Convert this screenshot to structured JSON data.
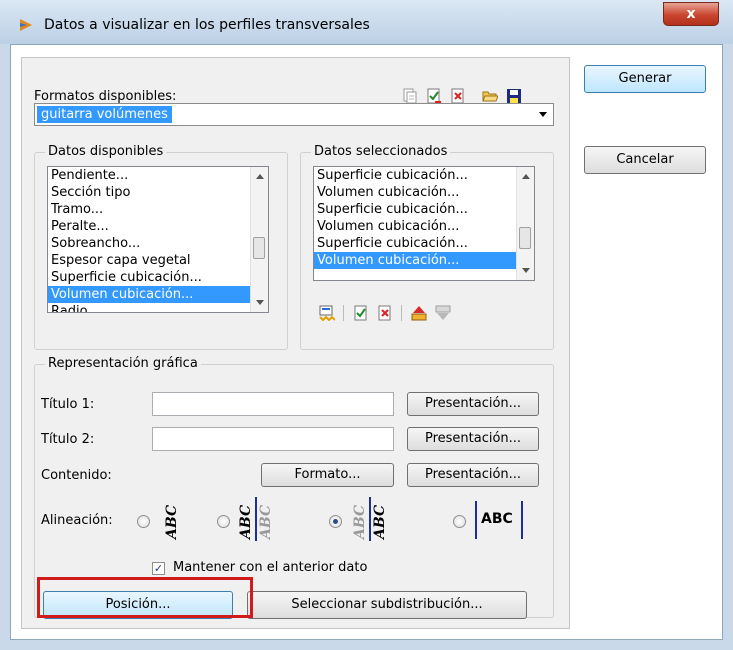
{
  "window": {
    "title": "Datos a visualizar en los perfiles transversales",
    "close_label": "x"
  },
  "formats": {
    "label": "Formatos disponibles:",
    "selected": "guitarra volúmenes"
  },
  "available": {
    "title": "Datos disponibles",
    "items": [
      "Pendiente...",
      "Sección tipo",
      "Tramo...",
      "Peralte...",
      "Sobreancho...",
      "Espesor capa vegetal",
      "Superficie cubicación...",
      "Volumen cubicación...",
      "Radio..."
    ],
    "selected_index": 7
  },
  "selected_data": {
    "title": "Datos seleccionados",
    "items": [
      "Superficie cubicación...",
      "Volumen cubicación...",
      "Superficie cubicación...",
      "Volumen cubicación...",
      "Superficie cubicación...",
      "Volumen cubicación..."
    ],
    "selected_index": 5
  },
  "graphic": {
    "title": "Representación gráfica",
    "title1_label": "Título 1:",
    "title1_value": "",
    "title2_label": "Título 2:",
    "title2_value": "",
    "content_label": "Contenido:",
    "alignment_label": "Alineación:",
    "presentation_label": "Presentación...",
    "format_label": "Formato...",
    "sample_text": "ABC",
    "keep_label": "Mantener con el anterior dato",
    "keep_checked": true,
    "alignment_selected": 3
  },
  "buttons": {
    "generate": "Generar",
    "cancel": "Cancelar",
    "position": "Posición...",
    "subdistribution": "Seleccionar subdistribución..."
  },
  "colors": {
    "selection": "#3399ff",
    "highlight": "#d11a1a"
  }
}
